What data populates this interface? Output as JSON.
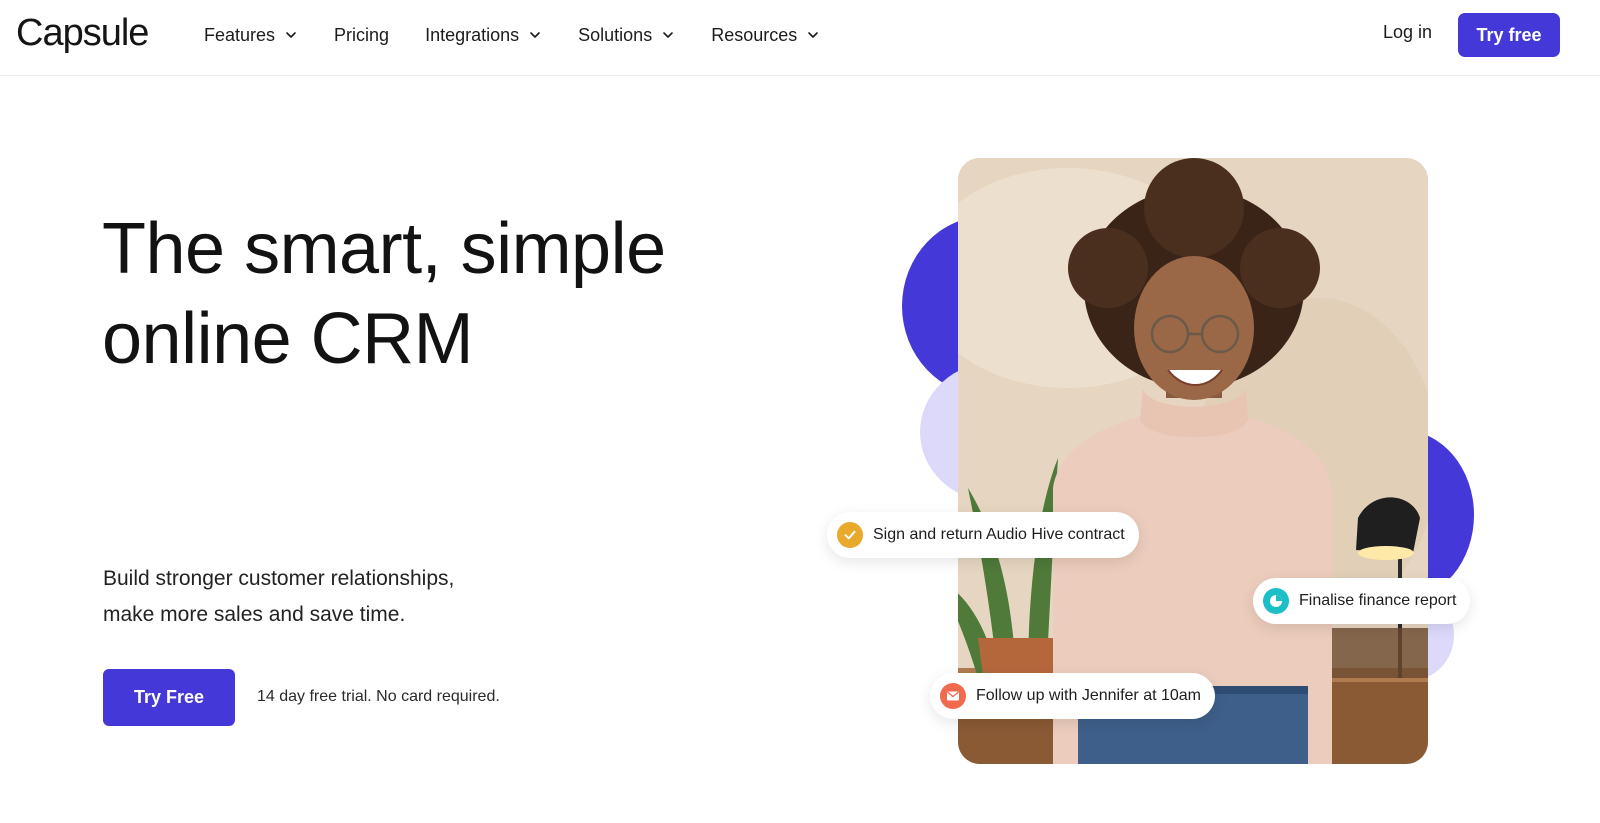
{
  "header": {
    "logo": "Capsule",
    "nav": [
      {
        "label": "Features",
        "has_dropdown": true
      },
      {
        "label": "Pricing",
        "has_dropdown": false
      },
      {
        "label": "Integrations",
        "has_dropdown": true
      },
      {
        "label": "Solutions",
        "has_dropdown": true
      },
      {
        "label": "Resources",
        "has_dropdown": true
      }
    ],
    "login_label": "Log in",
    "try_label": "Try free"
  },
  "hero": {
    "title_line1": "The smart, simple",
    "title_line2": "online CRM",
    "subtitle_line1": "Build stronger customer relationships,",
    "subtitle_line2": "make more sales and save time.",
    "cta_label": "Try Free",
    "trial_note": "14 day free trial. No card required."
  },
  "illustration": {
    "tasks": [
      {
        "text": "Sign and return Audio Hive contract",
        "icon": "check-icon",
        "color": "#e9a92b"
      },
      {
        "text": "Finalise finance report",
        "icon": "pie-chart-icon",
        "color": "#1cbfc7"
      },
      {
        "text": "Follow up with Jennifer at 10am",
        "icon": "mail-icon",
        "color": "#f06a4d"
      }
    ]
  },
  "colors": {
    "brand": "#4538d9",
    "brand_light": "#dcd9fb"
  }
}
